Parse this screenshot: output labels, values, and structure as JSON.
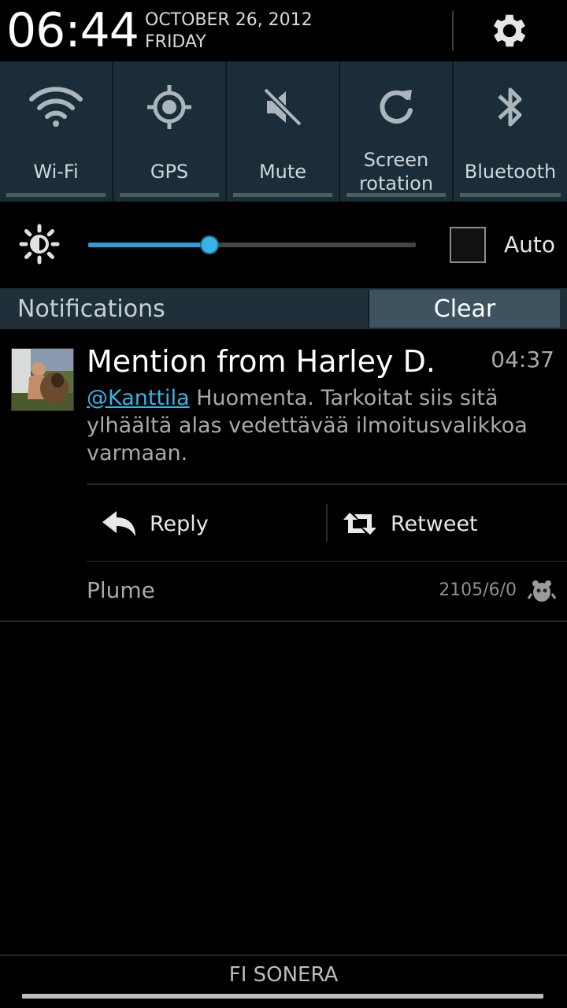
{
  "header": {
    "time": "06:44",
    "date_line1": "OCTOBER 26, 2012",
    "date_line2": "FRIDAY",
    "settings_icon": "gear-icon"
  },
  "quick_settings": [
    {
      "label": "Wi-Fi",
      "icon": "wifi-icon"
    },
    {
      "label": "GPS",
      "icon": "gps-icon"
    },
    {
      "label": "Mute",
      "icon": "mute-icon"
    },
    {
      "label": "Screen\nrotation",
      "icon": "rotation-icon"
    },
    {
      "label": "Bluetooth",
      "icon": "bluetooth-icon"
    }
  ],
  "brightness": {
    "icon": "brightness-icon",
    "level": 0.37,
    "auto_label": "Auto",
    "auto_checked": false
  },
  "notifications": {
    "title": "Notifications",
    "clear_label": "Clear"
  },
  "notification": {
    "title": "Mention from Harley D.",
    "time": "04:37",
    "mention": "@Kanttila",
    "body": " Huomenta. Tarkoitat siis sitä ylhäältä alas vedettävää ilmoitusvalikkoa varmaan.",
    "actions": {
      "reply": "Reply",
      "retweet": "Retweet"
    },
    "app_name": "Plume",
    "counts": "2105/6/0",
    "app_icon": "plume-app-icon"
  },
  "footer": {
    "carrier": "FI SONERA"
  },
  "colors": {
    "accent": "#33b5e5",
    "toggle_bg": "#1a2d38",
    "notif_bar_bg": "#20303a"
  }
}
